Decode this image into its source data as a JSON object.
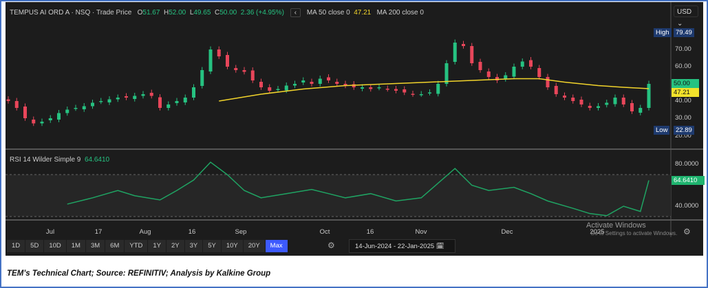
{
  "legend": {
    "name": "TEMPUS AI ORD A · NSQ · Trade Price",
    "o_label": "O",
    "o": "51.67",
    "h_label": "H",
    "h": "52.00",
    "l_label": "L",
    "l": "49.65",
    "c_label": "C",
    "c": "50.00",
    "change": "2.36 (+4.95%)",
    "ma50": "MA 50 close 0",
    "ma50_val": "47.21",
    "ma200": "MA 200 close 0",
    "chev": "‹"
  },
  "currency": "USD ⌄",
  "rsi_label": "RSI 14 Wilder Simple 9",
  "rsi_value": "64.6410",
  "tags": {
    "high_label": "High",
    "high": "79.49",
    "low_label": "Low",
    "low": "22.89",
    "last": "50.00",
    "ma": "47.21",
    "rsi": "64.6410"
  },
  "price_axis": [
    "70.00",
    "60.00",
    "40.00",
    "30.00",
    "20.00"
  ],
  "rsi_axis": [
    "80.0000",
    "40.0000"
  ],
  "x_axis": [
    "Jul",
    "17",
    "Aug",
    "16",
    "Sep",
    "Oct",
    "16",
    "Nov",
    "Dec",
    "2025"
  ],
  "ranges": [
    "1D",
    "5D",
    "10D",
    "1M",
    "3M",
    "6M",
    "YTD",
    "1Y",
    "2Y",
    "3Y",
    "5Y",
    "10Y",
    "20Y",
    "Max"
  ],
  "date_range": "14-Jun-2024  -  22-Jan-2025  🗓",
  "watermark": "Activate Windows",
  "watermark2": "Go to Settings to activate Windows.",
  "caption": "TEM’s Technical Chart; Source: REFINITIV; Analysis by Kalkine Group",
  "colors": {
    "up": "#26c281",
    "down": "#e8465a",
    "ma": "#f2d42b",
    "rsi": "#1fa463"
  },
  "chart_data": {
    "type": "candlestick",
    "title": "TEMPUS AI ORD A · NSQ · Trade Price",
    "period": [
      "14-Jun-2024",
      "22-Jan-2025"
    ],
    "ylim": [
      18,
      82
    ],
    "closes": [
      40,
      36,
      30,
      27,
      28,
      30,
      33,
      35,
      36,
      37,
      39,
      40,
      41,
      42,
      42,
      43,
      44,
      43,
      36,
      38,
      40,
      42,
      48,
      58,
      70,
      66,
      60,
      58,
      57,
      52,
      48,
      46,
      47,
      49,
      50,
      52,
      50,
      53,
      52,
      50,
      49,
      48,
      48,
      47,
      48,
      47,
      46,
      45,
      44,
      44,
      45,
      50,
      62,
      74,
      72,
      62,
      58,
      54,
      52,
      55,
      60,
      63,
      60,
      54,
      48,
      44,
      42,
      40,
      38,
      36,
      37,
      39,
      42,
      38,
      34,
      36,
      50
    ],
    "ma50": [
      [
        25,
        40
      ],
      [
        30,
        44
      ],
      [
        35,
        47
      ],
      [
        40,
        49
      ],
      [
        45,
        50
      ],
      [
        50,
        51
      ],
      [
        55,
        52
      ],
      [
        60,
        53
      ],
      [
        63,
        53
      ],
      [
        66,
        51
      ],
      [
        70,
        49
      ],
      [
        73,
        48
      ],
      [
        76,
        47.21
      ]
    ],
    "rsi": [
      [
        7,
        42
      ],
      [
        10,
        48
      ],
      [
        13,
        55
      ],
      [
        15,
        50
      ],
      [
        18,
        46
      ],
      [
        20,
        55
      ],
      [
        22,
        65
      ],
      [
        24,
        82
      ],
      [
        26,
        70
      ],
      [
        28,
        55
      ],
      [
        30,
        48
      ],
      [
        33,
        52
      ],
      [
        36,
        56
      ],
      [
        38,
        52
      ],
      [
        40,
        48
      ],
      [
        43,
        52
      ],
      [
        46,
        45
      ],
      [
        49,
        48
      ],
      [
        51,
        62
      ],
      [
        53,
        76
      ],
      [
        55,
        60
      ],
      [
        57,
        55
      ],
      [
        60,
        58
      ],
      [
        62,
        52
      ],
      [
        64,
        45
      ],
      [
        67,
        38
      ],
      [
        69,
        33
      ],
      [
        71,
        31
      ],
      [
        73,
        40
      ],
      [
        75,
        35
      ],
      [
        76,
        64.64
      ]
    ],
    "rsi_ylim": [
      28,
      86
    ]
  }
}
